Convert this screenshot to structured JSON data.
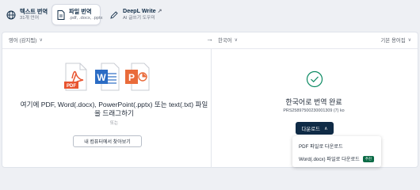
{
  "tabs": [
    {
      "title": "텍스트 번역",
      "subtitle": "31개 언어",
      "icon": "globe-icon",
      "active": false
    },
    {
      "title": "파일 번역",
      "subtitle": ".pdf, .docx, .pptx",
      "icon": "file-icon",
      "active": true
    },
    {
      "title": "DeepL Write",
      "subtitle": "AI 글쓰기 도우미",
      "icon": "pen-icon",
      "active": false,
      "external": "↗"
    }
  ],
  "source_lang": {
    "label": "영어 (감지됨)",
    "chevron": "∨"
  },
  "arrow": "→",
  "target_lang": {
    "label": "한국어",
    "chevron": "∨"
  },
  "glossary": {
    "label": "기본 용어집",
    "chevron": "∨"
  },
  "upload": {
    "file_icons": {
      "pdf": "PDF",
      "word": "W",
      "ppt": "P"
    },
    "drop_text": "여기에 PDF, Word(.docx), PowerPoint(.pptx) 또는 text(.txt) 파일을 드래그하기",
    "or_text": "또는",
    "browse_button": "내 컴퓨터에서 찾아보기"
  },
  "result": {
    "title": "한국어로 번역 완료",
    "file_info": "PRS25897500230001309 (7) ko",
    "download_button": "다운로드",
    "download_chevron": "∧",
    "menu": [
      {
        "label": "PDF 파일로 다운로드"
      },
      {
        "label": "Word(.docx) 파일로 다운로드",
        "badge": "추천"
      }
    ]
  },
  "colors": {
    "accent": "#0f2b46",
    "badge": "#0b6b46",
    "pdf": "#e8542f",
    "word": "#2b6cc4",
    "ppt": "#e96b3a",
    "success": "#0b8a62"
  }
}
